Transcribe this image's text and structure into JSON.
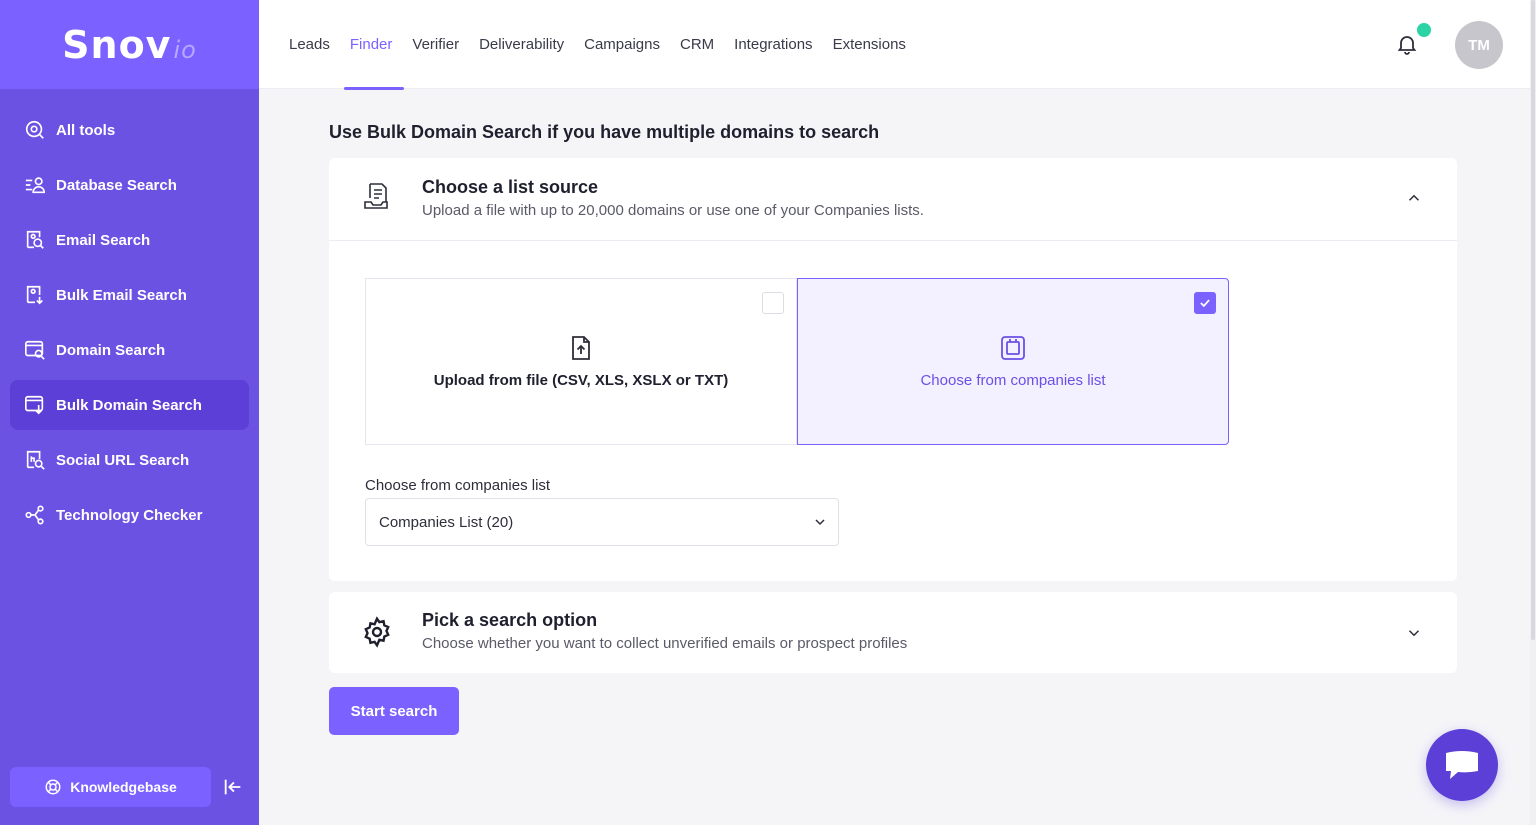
{
  "brand": {
    "name": "Snov",
    "suffix": "io"
  },
  "sidebar": {
    "items": [
      {
        "label": "All tools",
        "icon": "search-circle-icon"
      },
      {
        "label": "Database Search",
        "icon": "database-user-icon"
      },
      {
        "label": "Email Search",
        "icon": "email-search-icon"
      },
      {
        "label": "Bulk Email Search",
        "icon": "bulk-email-icon"
      },
      {
        "label": "Domain Search",
        "icon": "domain-search-icon"
      },
      {
        "label": "Bulk Domain Search",
        "icon": "bulk-domain-icon",
        "active": true
      },
      {
        "label": "Social URL Search",
        "icon": "social-url-icon"
      },
      {
        "label": "Technology Checker",
        "icon": "share-nodes-icon"
      }
    ],
    "knowledgebase_label": "Knowledgebase"
  },
  "topnav": {
    "tabs": [
      "Leads",
      "Finder",
      "Verifier",
      "Deliverability",
      "Campaigns",
      "CRM",
      "Integrations",
      "Extensions"
    ],
    "active_tab": "Finder",
    "avatar_initials": "TM"
  },
  "main": {
    "heading": "Use Bulk Domain Search if you have multiple domains to search",
    "list_source": {
      "title": "Choose a list source",
      "subtitle": "Upload a file with up to 20,000 domains or use one of your Companies lists.",
      "option_upload": "Upload from file (CSV, XLS, XSLX or TXT)",
      "option_companies": "Choose from companies list",
      "select_label": "Choose from companies list",
      "select_value": "Companies List (20)"
    },
    "search_option": {
      "title": "Pick a search option",
      "subtitle": "Choose whether you want to collect unverified emails or prospect profiles"
    },
    "start_button": "Start search"
  },
  "colors": {
    "accent": "#7b61ff",
    "sidebar": "#6c52e3",
    "online": "#2bd4a4"
  }
}
